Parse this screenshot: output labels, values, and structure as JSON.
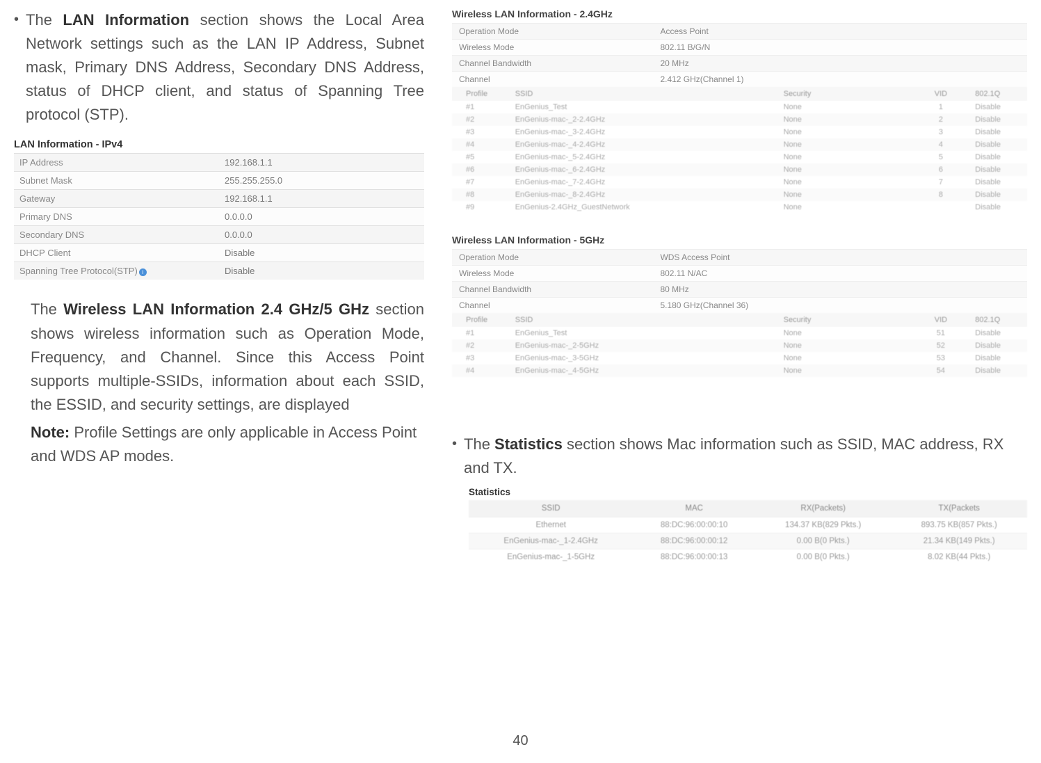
{
  "page_number": "40",
  "left": {
    "para1_pre": "The ",
    "para1_bold": "LAN Information",
    "para1_post": " section shows the Local Area Network settings such as the LAN IP Address, Subnet mask, Primary DNS Address, Secondary DNS Address, status of DHCP client, and status of Spanning Tree protocol (STP).",
    "lan_title": "LAN Information - IPv4",
    "lan_rows": [
      {
        "k": "IP Address",
        "v": "192.168.1.1"
      },
      {
        "k": "Subnet Mask",
        "v": "255.255.255.0"
      },
      {
        "k": "Gateway",
        "v": "192.168.1.1"
      },
      {
        "k": "Primary DNS",
        "v": "0.0.0.0"
      },
      {
        "k": "Secondary DNS",
        "v": "0.0.0.0"
      },
      {
        "k": "DHCP Client",
        "v": "Disable"
      },
      {
        "k": "Spanning Tree Protocol(STP)",
        "v": "Disable",
        "info": true
      }
    ],
    "para2_pre": "The ",
    "para2_bold": "Wireless LAN Information 2.4 GHz/5 GHz",
    "para2_post": " section shows wireless information such as Operation Mode, Frequency, and Channel. Since this Access Point supports multiple-SSIDs, information about each SSID, the ESSID, and security settings, are displayed",
    "note_label": "Note:",
    "note_text": " Profile Settings are only applicable in Access Point and WDS AP modes."
  },
  "right": {
    "wlan24_title": "Wireless LAN Information - 2.4GHz",
    "wlan24_top": [
      {
        "k": "Operation Mode",
        "v": "Access Point"
      },
      {
        "k": "Wireless Mode",
        "v": "802.11 B/G/N"
      },
      {
        "k": "Channel Bandwidth",
        "v": "20 MHz"
      },
      {
        "k": "Channel",
        "v": "2.412 GHz(Channel 1)"
      }
    ],
    "wlan24_head": {
      "profile": "Profile",
      "ssid": "SSID",
      "sec": "Security",
      "vid": "VID",
      "dot": "802.1Q"
    },
    "wlan24_rows": [
      {
        "profile": "#1",
        "ssid": "EnGenius_Test",
        "sec": "None",
        "vid": "1",
        "dot": "Disable"
      },
      {
        "profile": "#2",
        "ssid": "EnGenius-mac-_2-2.4GHz",
        "sec": "None",
        "vid": "2",
        "dot": "Disable"
      },
      {
        "profile": "#3",
        "ssid": "EnGenius-mac-_3-2.4GHz",
        "sec": "None",
        "vid": "3",
        "dot": "Disable"
      },
      {
        "profile": "#4",
        "ssid": "EnGenius-mac-_4-2.4GHz",
        "sec": "None",
        "vid": "4",
        "dot": "Disable"
      },
      {
        "profile": "#5",
        "ssid": "EnGenius-mac-_5-2.4GHz",
        "sec": "None",
        "vid": "5",
        "dot": "Disable"
      },
      {
        "profile": "#6",
        "ssid": "EnGenius-mac-_6-2.4GHz",
        "sec": "None",
        "vid": "6",
        "dot": "Disable"
      },
      {
        "profile": "#7",
        "ssid": "EnGenius-mac-_7-2.4GHz",
        "sec": "None",
        "vid": "7",
        "dot": "Disable"
      },
      {
        "profile": "#8",
        "ssid": "EnGenius-mac-_8-2.4GHz",
        "sec": "None",
        "vid": "8",
        "dot": "Disable"
      },
      {
        "profile": "#9",
        "ssid": "EnGenius-2.4GHz_GuestNetwork",
        "sec": "None",
        "vid": "",
        "dot": "Disable"
      }
    ],
    "wlan5_title": "Wireless LAN Information - 5GHz",
    "wlan5_top": [
      {
        "k": "Operation Mode",
        "v": "WDS Access Point"
      },
      {
        "k": "Wireless Mode",
        "v": "802.11 N/AC"
      },
      {
        "k": "Channel Bandwidth",
        "v": "80 MHz"
      },
      {
        "k": "Channel",
        "v": "5.180 GHz(Channel 36)"
      }
    ],
    "wlan5_rows": [
      {
        "profile": "#1",
        "ssid": "EnGenius_Test",
        "sec": "None",
        "vid": "51",
        "dot": "Disable"
      },
      {
        "profile": "#2",
        "ssid": "EnGenius-mac-_2-5GHz",
        "sec": "None",
        "vid": "52",
        "dot": "Disable"
      },
      {
        "profile": "#3",
        "ssid": "EnGenius-mac-_3-5GHz",
        "sec": "None",
        "vid": "53",
        "dot": "Disable"
      },
      {
        "profile": "#4",
        "ssid": "EnGenius-mac-_4-5GHz",
        "sec": "None",
        "vid": "54",
        "dot": "Disable"
      }
    ],
    "stats_bullet_pre": "The ",
    "stats_bullet_bold": "Statistics",
    "stats_bullet_post": " section shows Mac information such as SSID, MAC address, RX and TX.",
    "stats_title": "Statistics",
    "stats_head": {
      "ssid": "SSID",
      "mac": "MAC",
      "rx": "RX(Packets)",
      "tx": "TX(Packets"
    },
    "stats_rows": [
      {
        "ssid": "Ethernet",
        "mac": "88:DC:96:00:00:10",
        "rx": "134.37 KB(829 Pkts.)",
        "tx": "893.75 KB(857 Pkts.)"
      },
      {
        "ssid": "EnGenius-mac-_1-2.4GHz",
        "mac": "88:DC:96:00:00:12",
        "rx": "0.00 B(0 Pkts.)",
        "tx": "21.34 KB(149 Pkts.)"
      },
      {
        "ssid": "EnGenius-mac-_1-5GHz",
        "mac": "88:DC:96:00:00:13",
        "rx": "0.00 B(0 Pkts.)",
        "tx": "8.02 KB(44 Pkts.)"
      }
    ]
  }
}
